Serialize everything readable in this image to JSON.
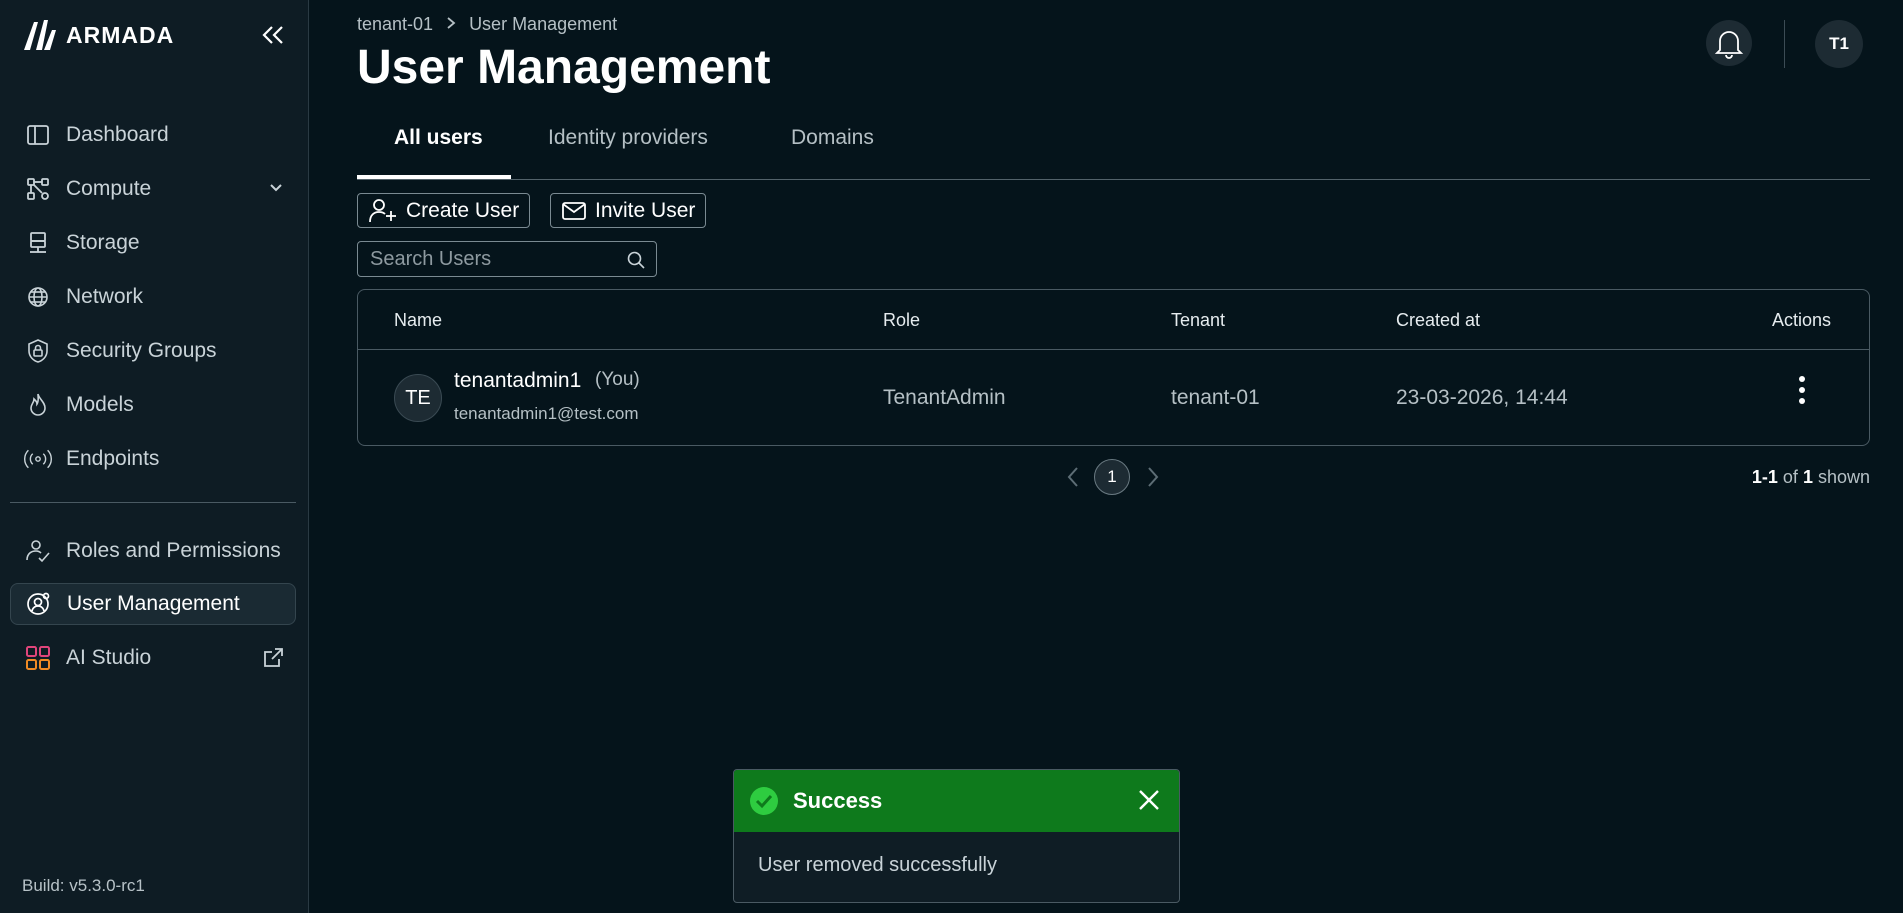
{
  "app": {
    "name": "ARMADA",
    "build": "Build: v5.3.0-rc1"
  },
  "sidebar": {
    "items": [
      {
        "label": "Dashboard",
        "icon": "dashboard-icon"
      },
      {
        "label": "Compute",
        "icon": "compute-icon"
      },
      {
        "label": "Storage",
        "icon": "storage-icon"
      },
      {
        "label": "Network",
        "icon": "globe-icon"
      },
      {
        "label": "Security Groups",
        "icon": "shield-lock-icon"
      },
      {
        "label": "Models",
        "icon": "flame-icon"
      },
      {
        "label": "Endpoints",
        "icon": "broadcast-icon"
      },
      {
        "label": "Roles and Permissions",
        "icon": "users-check-icon"
      },
      {
        "label": "User Management",
        "icon": "user-gear-icon"
      },
      {
        "label": "AI Studio",
        "icon": "grid-colorful-icon"
      }
    ]
  },
  "breadcrumb": {
    "tenant": "tenant-01",
    "current": "User Management"
  },
  "header": {
    "title": "User Management",
    "avatar_initials": "T1"
  },
  "tabs": [
    {
      "label": "All users"
    },
    {
      "label": "Identity providers"
    },
    {
      "label": "Domains"
    }
  ],
  "toolbar": {
    "create_label": "Create User",
    "invite_label": "Invite User"
  },
  "search": {
    "placeholder": "Search Users"
  },
  "table": {
    "columns": [
      "Name",
      "Role",
      "Tenant",
      "Created at",
      "Actions"
    ],
    "rows": [
      {
        "initials": "TE",
        "name": "tenantadmin1",
        "you": "(You)",
        "email": "tenantadmin1@test.com",
        "role": "TenantAdmin",
        "tenant": "tenant-01",
        "created": "23-03-2026, 14:44"
      }
    ]
  },
  "pagination": {
    "page": "1",
    "range": "1-1",
    "of": "of",
    "total": "1",
    "shown": "shown"
  },
  "toast": {
    "title": "Success",
    "message": "User removed successfully",
    "color": "#0e7a1c"
  }
}
